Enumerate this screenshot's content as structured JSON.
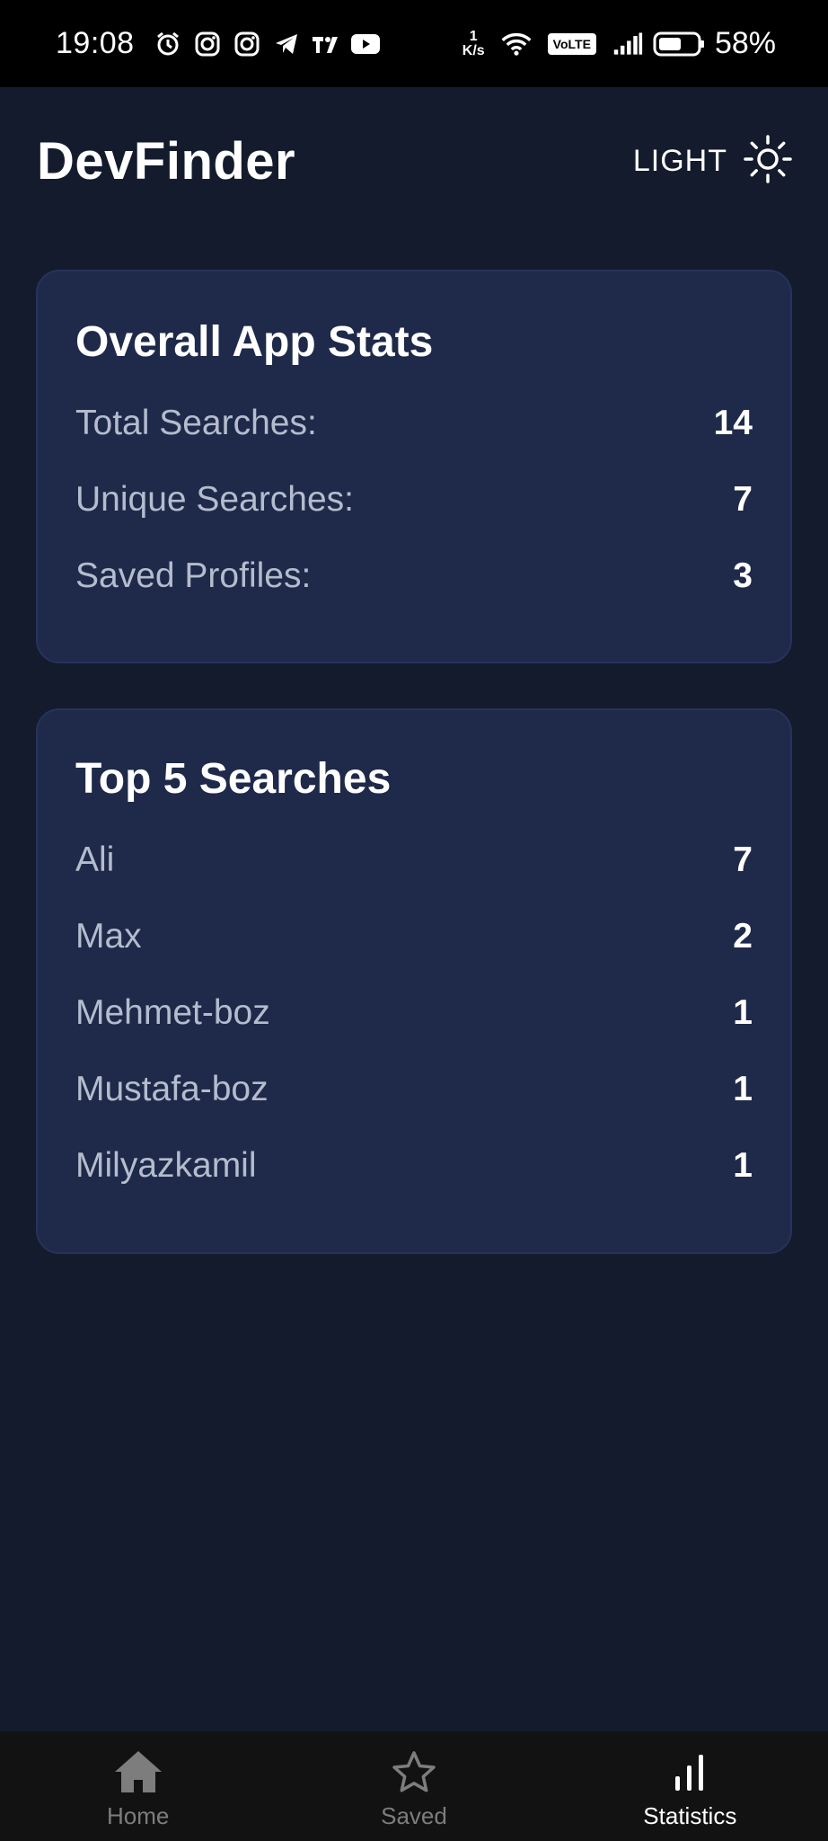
{
  "status_bar": {
    "time": "19:08",
    "net_speed_top": "1",
    "net_speed_bottom": "K/s",
    "volte": "VoLTE",
    "battery": "58%"
  },
  "header": {
    "title": "DevFinder",
    "theme_label": "LIGHT",
    "theme_icon": "sun-icon"
  },
  "overall_stats": {
    "title": "Overall App Stats",
    "rows": [
      {
        "label": "Total Searches:",
        "value": "14"
      },
      {
        "label": "Unique Searches:",
        "value": "7"
      },
      {
        "label": "Saved Profiles:",
        "value": "3"
      }
    ]
  },
  "top_searches": {
    "title": "Top 5 Searches",
    "rows": [
      {
        "label": "Ali",
        "value": "7"
      },
      {
        "label": "Max",
        "value": "2"
      },
      {
        "label": "Mehmet-boz",
        "value": "1"
      },
      {
        "label": "Mustafa-boz",
        "value": "1"
      },
      {
        "label": "Milyazkamil",
        "value": "1"
      }
    ]
  },
  "bottom_nav": {
    "items": [
      {
        "label": "Home",
        "icon": "home-icon",
        "active": false
      },
      {
        "label": "Saved",
        "icon": "star-icon",
        "active": false
      },
      {
        "label": "Statistics",
        "icon": "bar-chart-icon",
        "active": true
      }
    ]
  },
  "colors": {
    "background": "#141b2d",
    "card": "#1f2a4a",
    "nav_background": "#121212",
    "label": "#b4bccd",
    "nav_inactive": "#7d7d7d"
  }
}
